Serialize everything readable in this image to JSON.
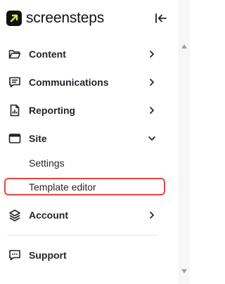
{
  "logo": {
    "text": "screensteps"
  },
  "nav": {
    "items": [
      {
        "label": "Content",
        "icon": "folder-icon",
        "chevron": "right"
      },
      {
        "label": "Communications",
        "icon": "message-icon",
        "chevron": "right"
      },
      {
        "label": "Reporting",
        "icon": "report-icon",
        "chevron": "right"
      },
      {
        "label": "Site",
        "icon": "browser-window-icon",
        "chevron": "down"
      },
      {
        "label": "Account",
        "icon": "layers-icon",
        "chevron": "right"
      },
      {
        "label": "Support",
        "icon": "chat-bubble-icon"
      }
    ],
    "site_subitems": [
      {
        "label": "Settings"
      },
      {
        "label": "Template editor",
        "highlighted": true
      }
    ]
  },
  "colors": {
    "highlight_border": "#e8453c",
    "logo_accent": "#c6f432"
  }
}
